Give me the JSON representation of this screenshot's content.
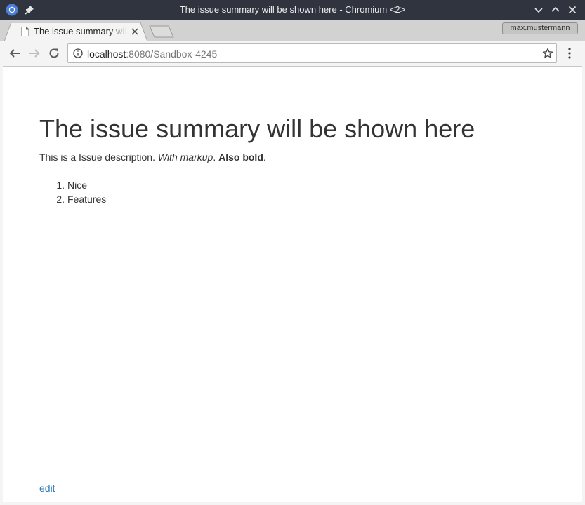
{
  "window": {
    "title": "The issue summary will be shown here - Chromium <2>",
    "icons": [
      "chromium-icon",
      "pin-icon",
      "minimize-icon",
      "maximize-icon",
      "close-icon"
    ]
  },
  "tabs": [
    {
      "title": "The issue summary will be shown here",
      "active": true
    }
  ],
  "profile": {
    "name": "max.mustermann"
  },
  "address_bar": {
    "host": "localhost",
    "path": ":8080/Sandbox-4245"
  },
  "page": {
    "heading": "The issue summary will be shown here",
    "description": {
      "plain": "This is a Issue description. ",
      "italic": "With markup",
      "sep": ". ",
      "bold": "Also bold",
      "end": "."
    },
    "list": [
      {
        "num": "1.",
        "text": "Nice"
      },
      {
        "num": "2.",
        "text": "Features"
      }
    ],
    "edit_label": "edit"
  },
  "colors": {
    "titlebar": "#2f343f",
    "link": "#337ab7",
    "text": "#333333"
  }
}
